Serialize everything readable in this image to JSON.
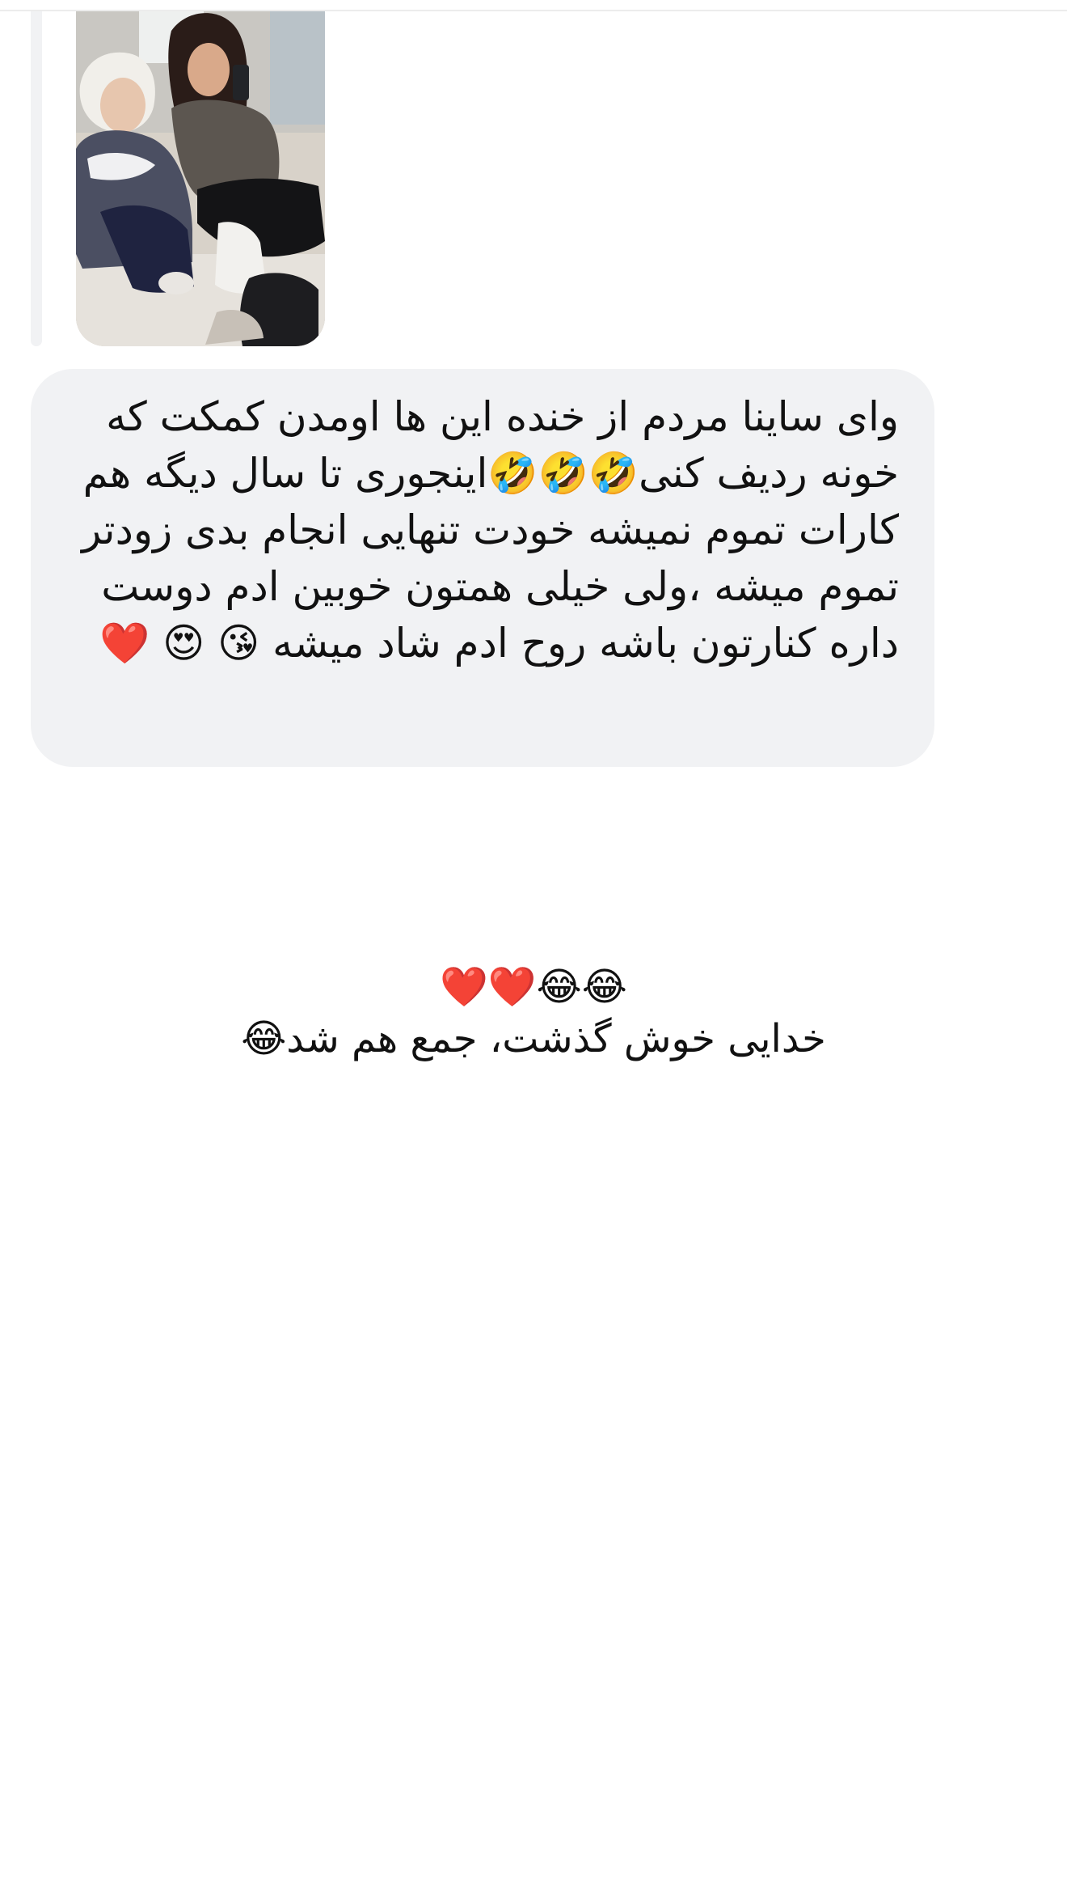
{
  "message": {
    "photo_icon": "shared-photo",
    "text": "وای ساینا مردم از خنده این ها اومدن کمکت که خونه ردیف کنی🤣🤣🤣اینجوری تا سال دیگه هم کارات تموم نمیشه خودت تنهایی انجام بدی زودتر تموم میشه ،ولی خیلی همتون خوبین ادم دوست داره کنارتون باشه روح ادم شاد میشه 😘 😍 ❤️"
  },
  "caption": {
    "line1": "😂😂❤️❤️",
    "line2": "خدایی خوش گذشت، جمع هم شد😂"
  },
  "colors": {
    "bubble": "#f1f2f4",
    "text": "#111111",
    "background": "#ffffff"
  }
}
